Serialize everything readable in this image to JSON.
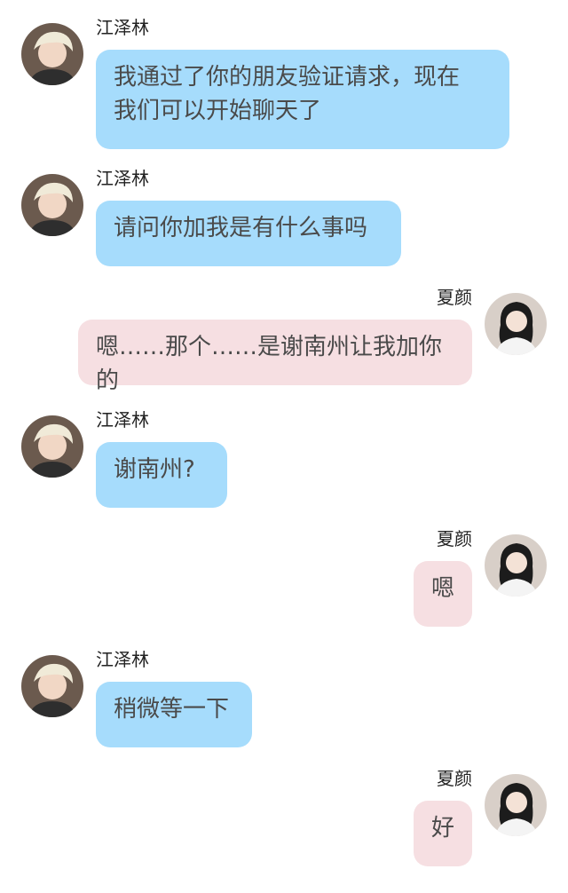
{
  "colors": {
    "left_bubble": "#a6dcfc",
    "right_bubble": "#f6dfe2",
    "text": "#4a4a4a",
    "name": "#222222"
  },
  "contacts": {
    "other": {
      "name": "江泽林",
      "avatar_icon": "avatar-blond-boy-icon"
    },
    "me": {
      "name": "夏颜",
      "avatar_icon": "avatar-dark-hair-girl-icon"
    }
  },
  "messages": [
    {
      "side": "left",
      "sender": "江泽林",
      "lines": [
        "我通过了你的朋友验证请求，现在",
        "我们可以开始聊天了"
      ]
    },
    {
      "side": "left",
      "sender": "江泽林",
      "lines": [
        "请问你加我是有什么事吗"
      ]
    },
    {
      "side": "right",
      "sender": "夏颜",
      "lines": [
        "嗯……那个……是谢南州让我加你的"
      ]
    },
    {
      "side": "left",
      "sender": "江泽林",
      "lines": [
        "谢南州?"
      ]
    },
    {
      "side": "right",
      "sender": "夏颜",
      "lines": [
        "嗯"
      ]
    },
    {
      "side": "left",
      "sender": "江泽林",
      "lines": [
        "稍微等一下"
      ]
    },
    {
      "side": "right",
      "sender": "夏颜",
      "lines": [
        "好"
      ]
    }
  ]
}
